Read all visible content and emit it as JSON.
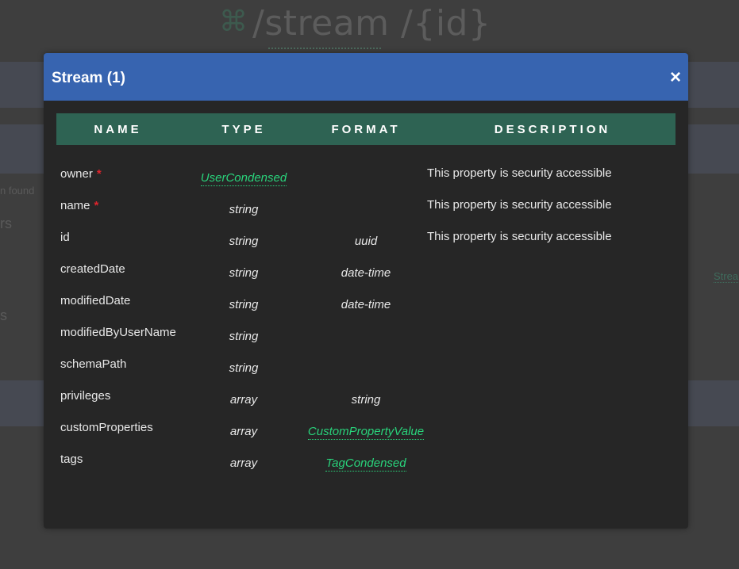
{
  "background": {
    "cmd_icon": "command-icon",
    "path_title": "/stream /{id}",
    "fragments": {
      "left_1": "n found",
      "left_2": "rs",
      "left_3": "s",
      "right_link": "Strea"
    }
  },
  "modal": {
    "title": "Stream (1)",
    "close_label": "×",
    "columns": [
      "NAME",
      "TYPE",
      "FORMAT",
      "DESCRIPTION"
    ],
    "rows": [
      {
        "name": "owner",
        "required": "*",
        "type": "UserCondensed",
        "format": "",
        "description": "This property is security accessible"
      },
      {
        "name": "name",
        "required": "*",
        "type": "string",
        "format": "",
        "description": "This property is security accessible"
      },
      {
        "name": "id",
        "required": "",
        "type": "string",
        "format": "uuid",
        "description": "This property is security accessible"
      },
      {
        "name": "createdDate",
        "required": "",
        "type": "string",
        "format": "date-time",
        "description": ""
      },
      {
        "name": "modifiedDate",
        "required": "",
        "type": "string",
        "format": "date-time",
        "description": ""
      },
      {
        "name": "modifiedByUserName",
        "required": "",
        "type": "string",
        "format": "",
        "description": ""
      },
      {
        "name": "schemaPath",
        "required": "",
        "type": "string",
        "format": "",
        "description": ""
      },
      {
        "name": "privileges",
        "required": "",
        "type": "array",
        "format": "string",
        "description": ""
      },
      {
        "name": "customProperties",
        "required": "",
        "type": "array",
        "format": "CustomPropertyValue",
        "description": ""
      },
      {
        "name": "tags",
        "required": "",
        "type": "array",
        "format": "TagCondensed",
        "description": ""
      }
    ]
  },
  "colors": {
    "modal_header": "#3764b0",
    "table_header": "#2e6353",
    "link": "#29d37b",
    "required": "#e0242c"
  }
}
